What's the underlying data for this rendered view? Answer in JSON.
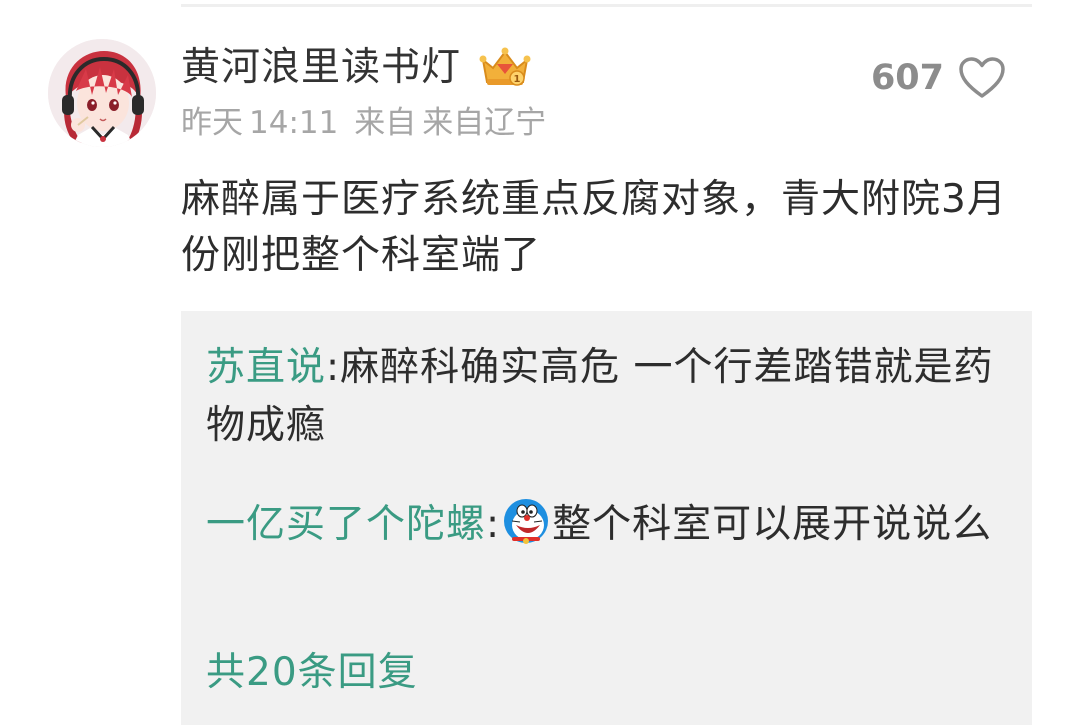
{
  "comment": {
    "username": "黄河浪里读书灯",
    "badge_icon": "crown-badge-icon",
    "meta": {
      "date": "昨天",
      "time": "14:11",
      "source_label": "来自",
      "location": "来自辽宁"
    },
    "like_count": "607",
    "text": "麻醉属于医疗系统重点反腐对象，青大附院3月份刚把整个科室端了"
  },
  "replies": [
    {
      "author": "苏直说",
      "separator": ":",
      "text": "麻醉科确实高危 一个行差踏错就是药物成瘾"
    },
    {
      "author": "一亿买了个陀螺",
      "separator": ":",
      "emoji": "doraemon-emoji",
      "text": "整个科室可以展开说说么"
    }
  ],
  "more_replies": "共20条回复",
  "colors": {
    "reply_author": "#3a9b83",
    "reply_background": "#f1f1f1",
    "meta_text": "#a6a6a6"
  }
}
